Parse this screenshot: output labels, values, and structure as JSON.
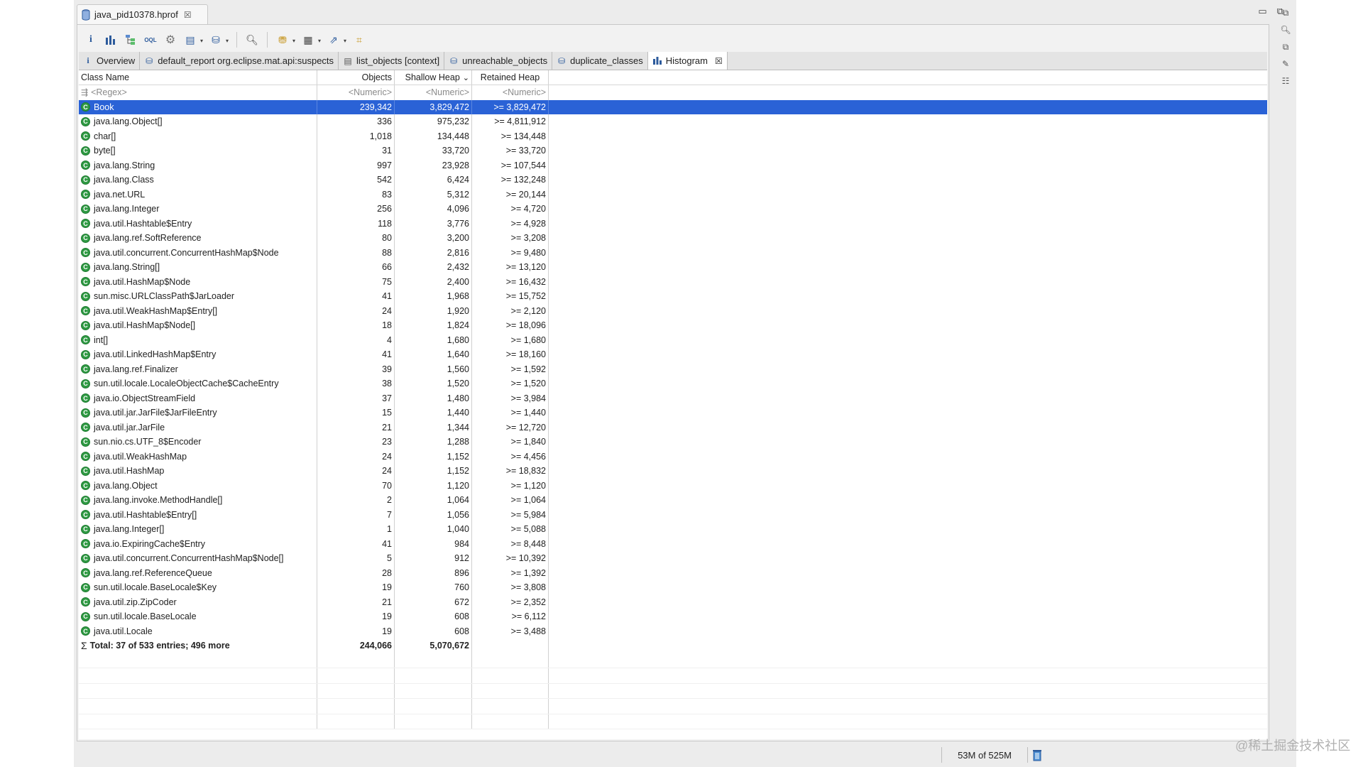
{
  "editor": {
    "title": "java_pid10378.hprof"
  },
  "tabs": [
    {
      "label": "Overview",
      "icon": "info-icon"
    },
    {
      "label": "default_report  org.eclipse.mat.api:suspects",
      "icon": "report-icon"
    },
    {
      "label": "list_objects [context]",
      "icon": "list-icon"
    },
    {
      "label": "unreachable_objects",
      "icon": "report-icon"
    },
    {
      "label": "duplicate_classes",
      "icon": "report-icon"
    },
    {
      "label": "Histogram",
      "icon": "histogram-icon",
      "active": true
    }
  ],
  "table": {
    "headers": [
      "Class Name",
      "Objects",
      "Shallow Heap",
      "Retained Heap"
    ],
    "sort_indicator": "⌄",
    "filter": [
      "<Regex>",
      "<Numeric>",
      "<Numeric>",
      "<Numeric>"
    ],
    "rows": [
      [
        "Book",
        "239,342",
        "3,829,472",
        ">= 3,829,472"
      ],
      [
        "java.lang.Object[]",
        "336",
        "975,232",
        ">= 4,811,912"
      ],
      [
        "char[]",
        "1,018",
        "134,448",
        ">= 134,448"
      ],
      [
        "byte[]",
        "31",
        "33,720",
        ">= 33,720"
      ],
      [
        "java.lang.String",
        "997",
        "23,928",
        ">= 107,544"
      ],
      [
        "java.lang.Class",
        "542",
        "6,424",
        ">= 132,248"
      ],
      [
        "java.net.URL",
        "83",
        "5,312",
        ">= 20,144"
      ],
      [
        "java.lang.Integer",
        "256",
        "4,096",
        ">= 4,720"
      ],
      [
        "java.util.Hashtable$Entry",
        "118",
        "3,776",
        ">= 4,928"
      ],
      [
        "java.lang.ref.SoftReference",
        "80",
        "3,200",
        ">= 3,208"
      ],
      [
        "java.util.concurrent.ConcurrentHashMap$Node",
        "88",
        "2,816",
        ">= 9,480"
      ],
      [
        "java.lang.String[]",
        "66",
        "2,432",
        ">= 13,120"
      ],
      [
        "java.util.HashMap$Node",
        "75",
        "2,400",
        ">= 16,432"
      ],
      [
        "sun.misc.URLClassPath$JarLoader",
        "41",
        "1,968",
        ">= 15,752"
      ],
      [
        "java.util.WeakHashMap$Entry[]",
        "24",
        "1,920",
        ">= 2,120"
      ],
      [
        "java.util.HashMap$Node[]",
        "18",
        "1,824",
        ">= 18,096"
      ],
      [
        "int[]",
        "4",
        "1,680",
        ">= 1,680"
      ],
      [
        "java.util.LinkedHashMap$Entry",
        "41",
        "1,640",
        ">= 18,160"
      ],
      [
        "java.lang.ref.Finalizer",
        "39",
        "1,560",
        ">= 1,592"
      ],
      [
        "sun.util.locale.LocaleObjectCache$CacheEntry",
        "38",
        "1,520",
        ">= 1,520"
      ],
      [
        "java.io.ObjectStreamField",
        "37",
        "1,480",
        ">= 3,984"
      ],
      [
        "java.util.jar.JarFile$JarFileEntry",
        "15",
        "1,440",
        ">= 1,440"
      ],
      [
        "java.util.jar.JarFile",
        "21",
        "1,344",
        ">= 12,720"
      ],
      [
        "sun.nio.cs.UTF_8$Encoder",
        "23",
        "1,288",
        ">= 1,840"
      ],
      [
        "java.util.WeakHashMap",
        "24",
        "1,152",
        ">= 4,456"
      ],
      [
        "java.util.HashMap",
        "24",
        "1,152",
        ">= 18,832"
      ],
      [
        "java.lang.Object",
        "70",
        "1,120",
        ">= 1,120"
      ],
      [
        "java.lang.invoke.MethodHandle[]",
        "2",
        "1,064",
        ">= 1,064"
      ],
      [
        "java.util.Hashtable$Entry[]",
        "7",
        "1,056",
        ">= 5,984"
      ],
      [
        "java.lang.Integer[]",
        "1",
        "1,040",
        ">= 5,088"
      ],
      [
        "java.io.ExpiringCache$Entry",
        "41",
        "984",
        ">= 8,448"
      ],
      [
        "java.util.concurrent.ConcurrentHashMap$Node[]",
        "5",
        "912",
        ">= 10,392"
      ],
      [
        "java.lang.ref.ReferenceQueue",
        "28",
        "896",
        ">= 1,392"
      ],
      [
        "sun.util.locale.BaseLocale$Key",
        "19",
        "760",
        ">= 3,808"
      ],
      [
        "java.util.zip.ZipCoder",
        "21",
        "672",
        ">= 2,352"
      ],
      [
        "sun.util.locale.BaseLocale",
        "19",
        "608",
        ">= 6,112"
      ],
      [
        "java.util.Locale",
        "19",
        "608",
        ">= 3,488"
      ]
    ],
    "total": {
      "label": "Total: 37 of 533 entries; 496 more",
      "objects": "244,066",
      "shallow": "5,070,672",
      "retained": ""
    }
  },
  "status": {
    "memory": "53M of 525M"
  },
  "watermark": "@稀土掘金技术社区",
  "colors": {
    "selection": "#2a62d6",
    "class_icon": "#2f9a43"
  }
}
